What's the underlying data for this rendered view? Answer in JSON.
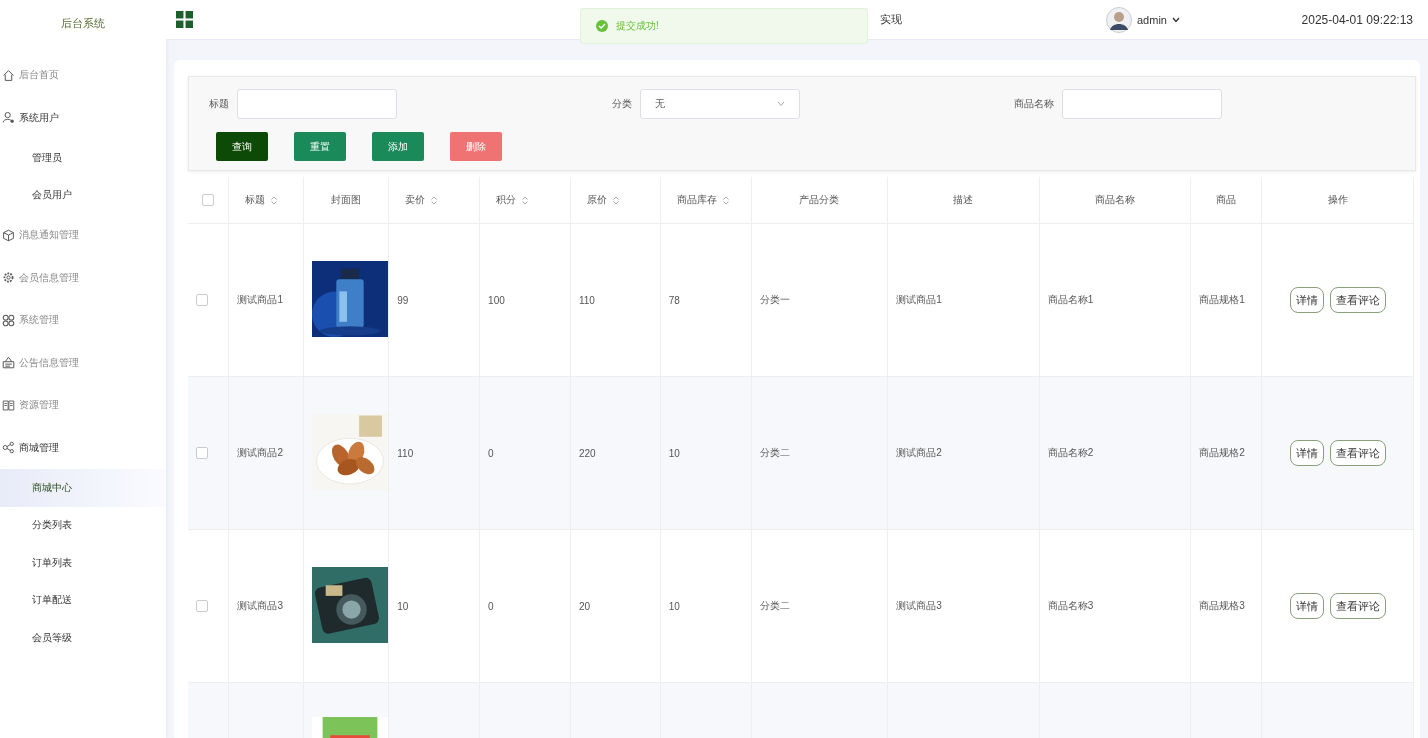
{
  "sidebar": {
    "title": "后台系统",
    "items": [
      {
        "label": "后台首页",
        "expanded": false
      },
      {
        "label": "系统用户",
        "expanded": true,
        "children": [
          {
            "label": "管理员",
            "selected": false
          },
          {
            "label": "会员用户",
            "selected": false
          }
        ]
      },
      {
        "label": "消息通知管理",
        "expanded": false
      },
      {
        "label": "会员信息管理",
        "expanded": false
      },
      {
        "label": "系统管理",
        "expanded": false
      },
      {
        "label": "公告信息管理",
        "expanded": false
      },
      {
        "label": "资源管理",
        "expanded": false
      },
      {
        "label": "商城管理",
        "expanded": true,
        "children": [
          {
            "label": "商城中心",
            "selected": true
          },
          {
            "label": "分类列表",
            "selected": false
          },
          {
            "label": "订单列表",
            "selected": false
          },
          {
            "label": "订单配送",
            "selected": false
          },
          {
            "label": "会员等级",
            "selected": false
          }
        ]
      }
    ]
  },
  "header": {
    "title": "实现",
    "user": "admin",
    "datetime": "2025-04-01 09:22:13"
  },
  "toast": {
    "message": "提交成功!"
  },
  "filters": [
    {
      "kind": "input",
      "label": "标题"
    },
    {
      "kind": "select",
      "label": "分类",
      "value": "无"
    },
    {
      "kind": "input",
      "label": "商品名称"
    }
  ],
  "buttons": [
    {
      "kind": "search",
      "label": "查询"
    },
    {
      "kind": "reset",
      "label": "重置"
    },
    {
      "kind": "add",
      "label": "添加"
    },
    {
      "kind": "delete",
      "label": "删除"
    }
  ],
  "table": {
    "all_selected": false,
    "columns": [
      {
        "label": "标题",
        "sortable": true
      },
      {
        "label": "封面图",
        "sortable": false
      },
      {
        "label": "卖价",
        "sortable": true
      },
      {
        "label": "积分",
        "sortable": true
      },
      {
        "label": "原价",
        "sortable": true
      },
      {
        "label": "商品库存",
        "sortable": true
      },
      {
        "label": "产品分类",
        "sortable": false
      },
      {
        "label": "描述",
        "sortable": false
      },
      {
        "label": "商品名称",
        "sortable": false
      },
      {
        "label": "商品",
        "sortable": false
      },
      {
        "label": "操作",
        "sortable": false
      }
    ],
    "rows": [
      {
        "selected": false,
        "cells": [
          "测试商品1",
          {
            "kind": "picture"
          },
          "99",
          "100",
          "110",
          "78",
          "分类一",
          "测试商品1",
          "商品名称1",
          "商品规格1"
        ],
        "actions": [
          "详情",
          "查看评论"
        ]
      },
      {
        "selected": false,
        "cells": [
          "测试商品2",
          {
            "kind": "picture"
          },
          "110",
          "0",
          "220",
          "10",
          "分类二",
          "测试商品2",
          "商品名称2",
          "商品规格2"
        ],
        "actions": [
          "详情",
          "查看评论"
        ]
      },
      {
        "selected": false,
        "cells": [
          "测试商品3",
          {
            "kind": "picture"
          },
          "10",
          "0",
          "20",
          "10",
          "分类二",
          "测试商品3",
          "商品名称3",
          "商品规格3"
        ],
        "actions": [
          "详情",
          "查看评论"
        ]
      },
      {
        "cells": [
          null,
          {
            "kind": "picture"
          }
        ]
      }
    ]
  }
}
